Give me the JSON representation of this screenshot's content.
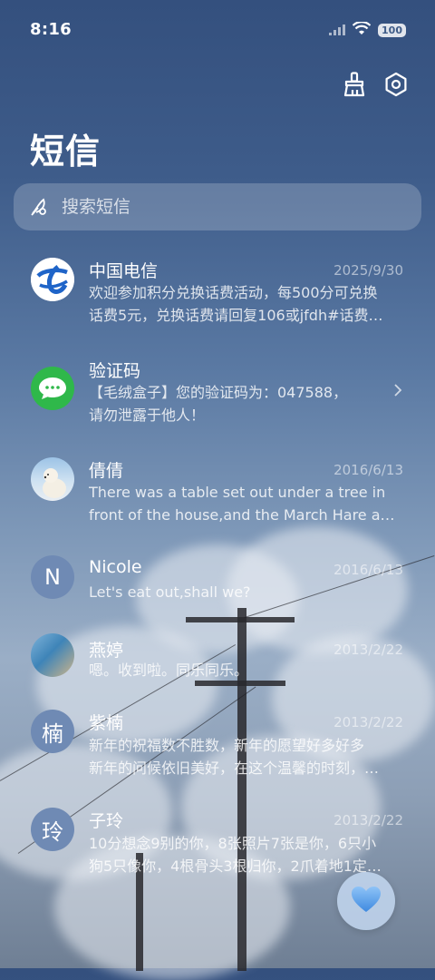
{
  "status": {
    "time": "8:16",
    "battery": "100"
  },
  "title": "短信",
  "search": {
    "placeholder": "搜索短信"
  },
  "conversations": [
    {
      "name": "中国电信",
      "date": "2025/9/30",
      "preview1": "欢迎参加积分兑换话费活动，每500分可兑换",
      "preview2": "话费5元，兑换话费请回复106或jfdh#话费…"
    },
    {
      "name": "验证码",
      "date": "",
      "preview1": "【毛绒盒子】您的验证码为：047588，",
      "preview2": "请勿泄露于他人！"
    },
    {
      "name": "倩倩",
      "date": "2016/6/13",
      "preview1": "There was a table set out under a tree in",
      "preview2": "front of the house,and the March Hare an…"
    },
    {
      "name": "Nicole",
      "date": "2016/6/13",
      "preview1": "Let's eat out,shall we?",
      "avatar_text": "N"
    },
    {
      "name": "燕婷",
      "date": "2013/2/22",
      "preview1": "嗯。收到啦。同乐同乐。"
    },
    {
      "name": "紫楠",
      "date": "2013/2/22",
      "preview1": "新年的祝福数不胜数，新年的愿望好多好多",
      "preview2": "新年的问候依旧美好，在这个温馨的时刻，…",
      "avatar_text": "楠"
    },
    {
      "name": "子玲",
      "date": "2013/2/22",
      "preview1": "10分想念9别的你，8张照片7张是你，6只小",
      "preview2": "狗5只像你，4根骨头3根归你，2爪着地1定…",
      "avatar_text": "玲"
    }
  ],
  "colors": {
    "letter_avatar": "#6f8ab4",
    "telecom_blue": "#1f64c8",
    "wechat_green": "#2fb84a"
  },
  "icons": [
    "signal-icon",
    "wifi-icon",
    "broom-icon",
    "settings-icon",
    "feather-icon",
    "chevron-right-icon",
    "heart-icon"
  ]
}
